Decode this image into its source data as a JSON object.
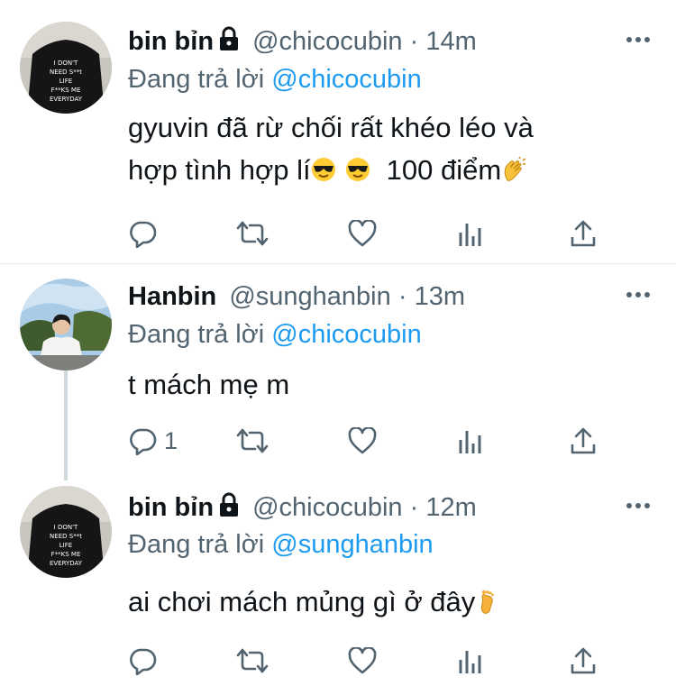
{
  "tweets": [
    {
      "name": "bin bỉn",
      "handle": "@chicocubin",
      "sep": "·",
      "time": "14m",
      "reply_prefix": "Đang trả lời",
      "reply_to": "@chicocubin",
      "text_line1": "gyuvin đã rừ chối rất khéo léo và",
      "text_line2a": "hợp tình hợp lí",
      "text_line2b": "100 điểm",
      "emoji": [
        "smiling-face-with-sunglasses",
        "smiling-face-with-sunglasses",
        "clapping-hands"
      ],
      "reply_count": "",
      "locked": true,
      "avatar_shirt_text": [
        "I DON'T",
        "NEED S**t",
        "LIFE",
        "F**KS ME",
        "EVERYDAY"
      ]
    },
    {
      "name": "Hanbin",
      "handle": "@sunghanbin",
      "sep": "·",
      "time": "13m",
      "reply_prefix": "Đang trả lời",
      "reply_to": "@chicocubin",
      "text_line1": "t mách mẹ m",
      "reply_count": "1",
      "locked": false
    },
    {
      "name": "bin bỉn",
      "handle": "@chicocubin",
      "sep": "·",
      "time": "12m",
      "reply_prefix": "Đang trả lời",
      "reply_to": "@sunghanbin",
      "text_line1": "ai chơi mách mủng gì ở đây",
      "emoji": [
        "foot"
      ],
      "reply_count": "",
      "locked": true,
      "avatar_shirt_text": [
        "I DON'T",
        "NEED S**t",
        "LIFE",
        "F**KS ME",
        "EVERYDAY"
      ]
    }
  ],
  "colors": {
    "text": "#0f1419",
    "secondary": "#536471",
    "link": "#1d9bf0",
    "divider": "#e1e8ed"
  },
  "icons": [
    "reply-icon",
    "retweet-icon",
    "like-icon",
    "analytics-icon",
    "share-icon",
    "more-icon",
    "lock-icon"
  ]
}
